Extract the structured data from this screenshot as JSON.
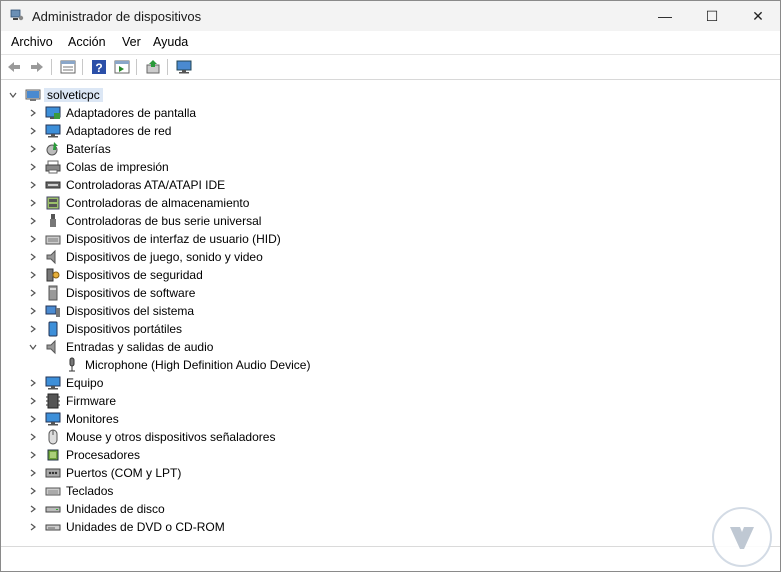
{
  "window": {
    "title": "Administrador de dispositivos"
  },
  "window_controls": {
    "minimize": "—",
    "maximize": "☐",
    "close": "✕"
  },
  "menu": [
    "Archivo",
    "Acción",
    "Ver",
    "Ayuda"
  ],
  "toolbar": [
    "back-icon",
    "forward-icon",
    "properties-view-icon",
    "help-icon",
    "action-view-icon",
    "update-driver-icon",
    "scan-hardware-icon"
  ],
  "tree": {
    "root": "solveticpc",
    "categories": [
      {
        "label": "Adaptadores de pantalla",
        "icon": "display-adapter-icon"
      },
      {
        "label": "Adaptadores de red",
        "icon": "network-adapter-icon"
      },
      {
        "label": "Baterías",
        "icon": "battery-icon"
      },
      {
        "label": "Colas de impresión",
        "icon": "printer-icon"
      },
      {
        "label": "Controladoras ATA/ATAPI IDE",
        "icon": "ide-controller-icon"
      },
      {
        "label": "Controladoras de almacenamiento",
        "icon": "storage-controller-icon"
      },
      {
        "label": "Controladoras de bus serie universal",
        "icon": "usb-icon"
      },
      {
        "label": "Dispositivos de interfaz de usuario (HID)",
        "icon": "hid-icon"
      },
      {
        "label": "Dispositivos de juego, sonido y video",
        "icon": "speaker-icon"
      },
      {
        "label": "Dispositivos de seguridad",
        "icon": "security-device-icon"
      },
      {
        "label": "Dispositivos de software",
        "icon": "software-device-icon"
      },
      {
        "label": "Dispositivos del sistema",
        "icon": "system-device-icon"
      },
      {
        "label": "Dispositivos portátiles",
        "icon": "portable-device-icon"
      },
      {
        "label": "Entradas y salidas de audio",
        "icon": "audio-io-icon",
        "expanded": true,
        "children": [
          {
            "label": "Microphone (High Definition Audio Device)",
            "icon": "microphone-icon"
          }
        ]
      },
      {
        "label": "Equipo",
        "icon": "computer-icon"
      },
      {
        "label": "Firmware",
        "icon": "firmware-icon"
      },
      {
        "label": "Monitores",
        "icon": "monitor-icon"
      },
      {
        "label": "Mouse y otros dispositivos señaladores",
        "icon": "mouse-icon"
      },
      {
        "label": "Procesadores",
        "icon": "processor-icon"
      },
      {
        "label": "Puertos (COM y LPT)",
        "icon": "port-icon"
      },
      {
        "label": "Teclados",
        "icon": "keyboard-icon"
      },
      {
        "label": "Unidades de disco",
        "icon": "disk-drive-icon"
      },
      {
        "label": "Unidades de DVD o CD-ROM",
        "icon": "dvd-drive-icon"
      }
    ]
  },
  "colors": {
    "selection": "#dce7f5",
    "titlebar": "#f3f3f3"
  }
}
